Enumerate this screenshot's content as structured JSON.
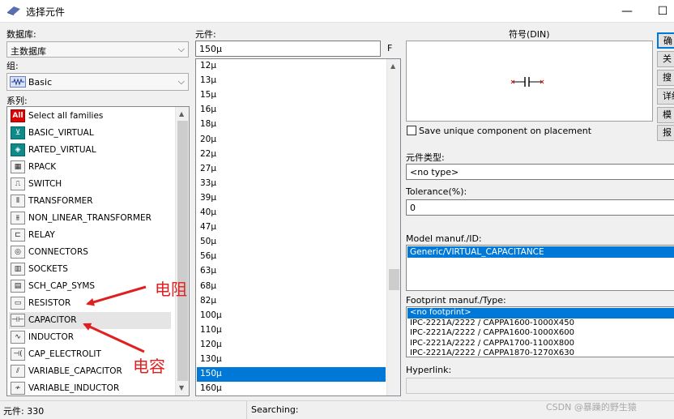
{
  "window": {
    "title": "选择元件",
    "minimize_glyph": "—",
    "close_glyph": "☐"
  },
  "database": {
    "label": "数据库:",
    "value": "主数据库"
  },
  "group": {
    "label": "组:",
    "value": "Basic"
  },
  "family": {
    "label": "系列:",
    "items": [
      {
        "label": "Select all families",
        "icon": "all-icon",
        "glyph": "All"
      },
      {
        "label": "BASIC_VIRTUAL",
        "icon": "basic-virtual-icon",
        "glyph": "⊻"
      },
      {
        "label": "RATED_VIRTUAL",
        "icon": "rated-virtual-icon",
        "glyph": "◈"
      },
      {
        "label": "RPACK",
        "icon": "rpack-icon",
        "glyph": "▦"
      },
      {
        "label": "SWITCH",
        "icon": "switch-icon",
        "glyph": "⎍"
      },
      {
        "label": "TRANSFORMER",
        "icon": "transformer-icon",
        "glyph": "⫴"
      },
      {
        "label": "NON_LINEAR_TRANSFORMER",
        "icon": "non-linear-transformer-icon",
        "glyph": "⫵"
      },
      {
        "label": "RELAY",
        "icon": "relay-icon",
        "glyph": "⊏"
      },
      {
        "label": "CONNECTORS",
        "icon": "connectors-icon",
        "glyph": "◎"
      },
      {
        "label": "SOCKETS",
        "icon": "sockets-icon",
        "glyph": "▥"
      },
      {
        "label": "SCH_CAP_SYMS",
        "icon": "sch-cap-syms-icon",
        "glyph": "▤"
      },
      {
        "label": "RESISTOR",
        "icon": "resistor-icon",
        "glyph": "▭"
      },
      {
        "label": "CAPACITOR",
        "icon": "capacitor-icon",
        "glyph": "⊣⊢"
      },
      {
        "label": "INDUCTOR",
        "icon": "inductor-icon",
        "glyph": "∿"
      },
      {
        "label": "CAP_ELECTROLIT",
        "icon": "cap-electrolit-icon",
        "glyph": "⊣("
      },
      {
        "label": "VARIABLE_CAPACITOR",
        "icon": "variable-capacitor-icon",
        "glyph": "⫽"
      },
      {
        "label": "VARIABLE_INDUCTOR",
        "icon": "variable-inductor-icon",
        "glyph": "≁"
      }
    ]
  },
  "component": {
    "label": "元件:",
    "value": "150µ",
    "side_label": "F",
    "items": [
      "12µ",
      "13µ",
      "15µ",
      "16µ",
      "18µ",
      "20µ",
      "22µ",
      "27µ",
      "33µ",
      "39µ",
      "40µ",
      "47µ",
      "50µ",
      "56µ",
      "63µ",
      "68µ",
      "82µ",
      "100µ",
      "110µ",
      "120µ",
      "130µ",
      "150µ",
      "160µ"
    ]
  },
  "symbol": {
    "label": "符号(DIN)"
  },
  "save_unique": {
    "label": "Save unique component on placement"
  },
  "component_type": {
    "label": "元件类型:",
    "value": "<no type>"
  },
  "tolerance": {
    "label": "Tolerance(%):",
    "value": "0"
  },
  "model": {
    "label": "Model manuf./ID:",
    "value": "Generic/VIRTUAL_CAPACITANCE"
  },
  "footprint": {
    "label": "Footprint manuf./Type:",
    "items": [
      "<no footprint>",
      "IPC-2221A/2222 / CAPPA1600-1000X450",
      "IPC-2221A/2222 / CAPPA1600-1000X600",
      "IPC-2221A/2222 / CAPPA1700-1100X800",
      "IPC-2221A/2222 / CAPPA1870-1270X630"
    ]
  },
  "hyperlink": {
    "label": "Hyperlink:"
  },
  "side_buttons": [
    "确",
    "关",
    "搜",
    "详细",
    "模",
    "报"
  ],
  "status": {
    "count": "元件: 330",
    "searching": "Searching:"
  },
  "annotations": {
    "resistor": "电阻",
    "capacitor": "电容",
    "color": "#e02020"
  },
  "watermark": "CSDN @暴躁的野生猿",
  "colors": {
    "selection": "#0078d7"
  }
}
